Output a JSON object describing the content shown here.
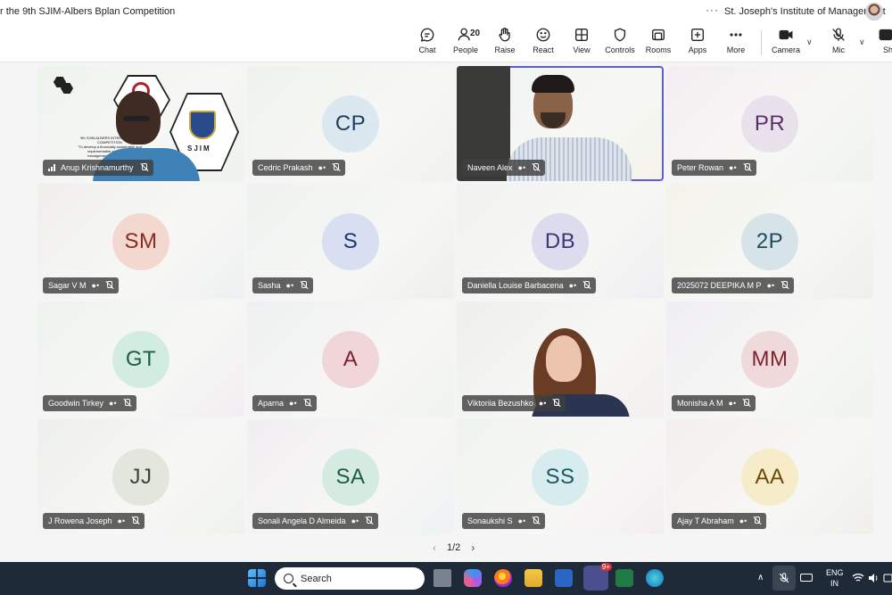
{
  "window": {
    "title": "r the 9th SJIM-Albers Bplan Competition",
    "more": "···",
    "org": "St. Joseph's Institute of Management"
  },
  "toolbar": {
    "chat": "Chat",
    "people": "People",
    "people_count": "20",
    "raise": "Raise",
    "react": "React",
    "view": "View",
    "controls": "Controls",
    "rooms": "Rooms",
    "apps": "Apps",
    "more": "More",
    "camera": "Camera",
    "mic": "Mic",
    "share": "Sha"
  },
  "participants": [
    {
      "name": "Anup Krishnamurthy",
      "initials": "",
      "video": "poster"
    },
    {
      "name": "Cedric Prakash",
      "initials": "CP",
      "circle": "#dbe8f0",
      "text": "#1d3f63"
    },
    {
      "name": "Naveen Alex",
      "initials": "",
      "video": "naveen"
    },
    {
      "name": "Peter Rowan",
      "initials": "PR",
      "circle": "#e9e1ec",
      "text": "#5a2f6b"
    },
    {
      "name": "Sagar V M",
      "initials": "SM",
      "circle": "#f3d8d0",
      "text": "#8a2d1f"
    },
    {
      "name": "Sasha",
      "initials": "S",
      "circle": "#d7dff0",
      "text": "#1e3573"
    },
    {
      "name": "Daniella Louise Barbacena",
      "initials": "DB",
      "circle": "#dddcef",
      "text": "#3c3677"
    },
    {
      "name": "2025072 DEEPIKA M P",
      "initials": "2P",
      "circle": "#d6e4ea",
      "text": "#1f4b5c"
    },
    {
      "name": "Goodwin Tirkey",
      "initials": "GT",
      "circle": "#d3ece1",
      "text": "#1e5c44"
    },
    {
      "name": "Aparna",
      "initials": "A",
      "circle": "#f0d6d9",
      "text": "#7a1f2c"
    },
    {
      "name": "Viktoriia Bezushko",
      "initials": "",
      "video": "vik"
    },
    {
      "name": "Monisha A M",
      "initials": "MM",
      "circle": "#efd9da",
      "text": "#7a2530"
    },
    {
      "name": "J Rowena Joseph",
      "initials": "JJ",
      "circle": "#e3e6dd",
      "text": "#3d4432"
    },
    {
      "name": "Sonali Angela D Almeida",
      "initials": "SA",
      "circle": "#d5ebe1",
      "text": "#1b5a45"
    },
    {
      "name": "Sonaukshi S",
      "initials": "SS",
      "circle": "#d6ecef",
      "text": "#175a66"
    },
    {
      "name": "Ajay T Abraham",
      "initials": "AA",
      "circle": "#f7ecc9",
      "text": "#6b4a06"
    }
  ],
  "poster": {
    "line1": "9th SJIM-ALBERS INTERNATIONAL",
    "line2": "COMPETITION",
    "line3": "\"To develop a financially sustainable and",
    "line4": "implementable and scalable",
    "line5": "management to bring meani",
    "logo_text": "SJIM"
  },
  "pager": {
    "label": "1/2",
    "prev": "‹",
    "next": "›"
  },
  "taskbar": {
    "search": "Search",
    "lang1": "ENG",
    "lang2": "IN",
    "teams_badge": "9+"
  }
}
